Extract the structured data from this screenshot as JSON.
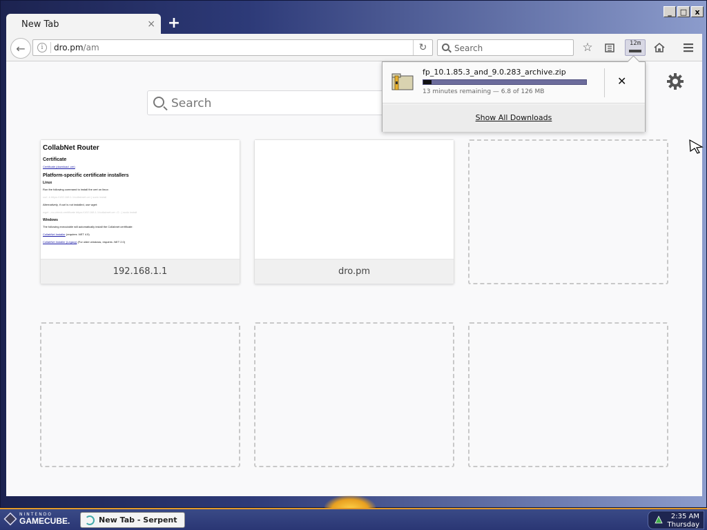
{
  "window": {
    "minimize_label": "_",
    "maximize_label": "□",
    "close_label": "x"
  },
  "tab": {
    "title": "New Tab",
    "close_label": "×",
    "new_tab_label": "+"
  },
  "navbar": {
    "url_host": "dro.pm",
    "url_path": "/am",
    "search_placeholder": "Search",
    "download_time": "12m"
  },
  "newtab_page": {
    "search_placeholder": "Search",
    "tiles": [
      {
        "caption": "192.168.1.1"
      },
      {
        "caption": "dro.pm"
      }
    ],
    "thumb_doc": {
      "title": "CollabNet Router",
      "certificate_heading": "Certificate",
      "certificate_link": "Certificate (download .cer)",
      "platform_heading": "Platform-specific certificate installers",
      "linux_heading": "Linux",
      "linux_text": "Run the following command to install the cert on linux:",
      "linux_code": "curl -k https://192.168.1.1/collabnet.cer | sudo install",
      "alt_text": "Alternatively, if curl is not installed, use wget:",
      "alt_code": "wget --no-check-certificate https://192.168.1.1/collabnet.cer -O - | sudo install",
      "windows_heading": "Windows",
      "windows_text": "The following executable will automatically install the Collabnet certificate:",
      "windows_link1": "CollabNet Installer",
      "windows_link1_suffix": " (requires .NET 4.5)",
      "windows_link2": "CollabNet Installer (Legacy)",
      "windows_link2_suffix": " (For older windows, requires .NET 2.0)"
    }
  },
  "download_panel": {
    "filename": "fp_10.1.85.3_and_9.0.283_archive.zip",
    "progress": 0.05,
    "status": "13 minutes remaining — 6.8 of 126 MB",
    "cancel_label": "✕",
    "show_all_label": "Show All Downloads"
  },
  "taskbar": {
    "brand_small": "NINTENDO",
    "brand_big": "GAMECUBE.",
    "task_label": "New Tab - Serpent",
    "time": "2:35 AM",
    "day": "Thursday"
  },
  "colors": {
    "accent": "#2d3a78",
    "taskbar_border": "#e49b2a",
    "progress_track": "#6c6c9c"
  }
}
